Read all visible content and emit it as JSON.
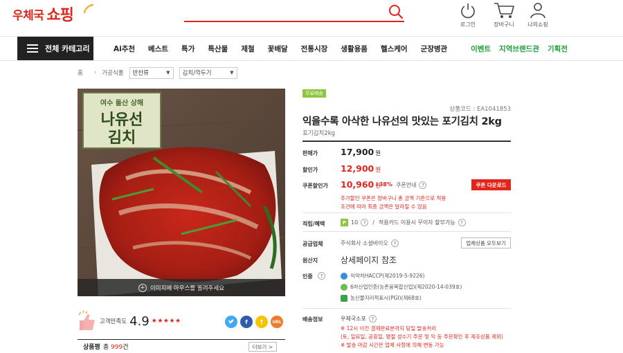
{
  "header": {
    "logo_main": "우체국",
    "logo_sub": "쇼핑",
    "icons": [
      {
        "name": "power-icon",
        "label": "로그인"
      },
      {
        "name": "cart-icon",
        "label": "장바구니"
      },
      {
        "name": "person-icon",
        "label": "나의쇼핑"
      }
    ]
  },
  "nav": {
    "all_category": "전체 카테고리",
    "items": [
      "Ai추천",
      "베스트",
      "특가",
      "특산물",
      "제철",
      "꽃배달",
      "전통시장",
      "생활용품",
      "헬스케어",
      "군장병관"
    ],
    "right_items": [
      "이벤트",
      "지역브랜드관",
      "기획전"
    ]
  },
  "breadcrumb": {
    "home": "홈",
    "level1": "가공식품",
    "level2": "반찬류",
    "level3": "김치/깍두기"
  },
  "image": {
    "sign_line1": "여수 돌산 상해",
    "sign_line2": "나유선",
    "sign_line3": "김치",
    "caption": "이미지에 마우스를 올려주세요"
  },
  "rating": {
    "label": "고객만족도",
    "score": "4.9",
    "stars": "★★★★★",
    "stars_value": 5
  },
  "share": [
    "t",
    "f",
    "",
    "URL"
  ],
  "review": {
    "label": "상품평",
    "count_prefix": "총",
    "count": "999",
    "count_suffix": "건",
    "more": "더보기 >"
  },
  "product": {
    "badge": "무료배송",
    "code": "상품코드 : EA1041853",
    "title": "익을수록 아삭한 나유선의 맛있는 포기김치 2kg",
    "subtitle": "포기김치2kg"
  },
  "pricing": {
    "sale_label": "판매가",
    "sale_price": "17,900",
    "discount_label": "할인가",
    "discount_price": "12,900",
    "coupon_label": "쿠폰할인가",
    "coupon_price": "10,960",
    "won": "원",
    "discount_rate": "↓38%",
    "coupon_info": "쿠폰안내",
    "coupon_button": "쿠폰 다운로드",
    "coupon_note1": "추가할인 쿠폰은 장바구니 총 금액 기준으로 적용",
    "coupon_note2": "조건에 따라 최종 금액은 달라질 수 있음"
  },
  "points": {
    "label": "적립/혜택",
    "p_icon": "P",
    "points": "10",
    "separator": "/",
    "card_text": "적용카드 이용시 무이자 할부가능"
  },
  "supplier": {
    "label": "공급업체",
    "name": "주식회사 소셜바이오",
    "button": "업체상품 모두보기"
  },
  "origin": {
    "label": "원산지",
    "value": "상세페이지 참조"
  },
  "certification": {
    "label": "인증",
    "items": [
      {
        "text": "식약처HACCP(제2019-5-9226)",
        "color": "#3a8dde"
      },
      {
        "text": "6차산업인증(농촌융복합산업)(제2020-14-039호)",
        "color": "#6cbf4b"
      },
      {
        "text": "농산물지리적표시(PGI)(제68호)",
        "color": "#3aa24a"
      }
    ]
  },
  "shipping": {
    "label": "배송정보",
    "method": "우체국소포",
    "notes": [
      "※ 12시 이전 결제완료분까지 당일 발송처리",
      "(토, 일요일, 공휴일, 명절 성수기 주문 및 익 등 주문확인 후 제조상품 제외)",
      "※ 발송 마감 시간은 업체 사정에 의해 변동 가능"
    ]
  },
  "colors": {
    "brand_red": "#e1251b",
    "green": "#8dc63f",
    "nav_green": "#1f9e3a"
  }
}
